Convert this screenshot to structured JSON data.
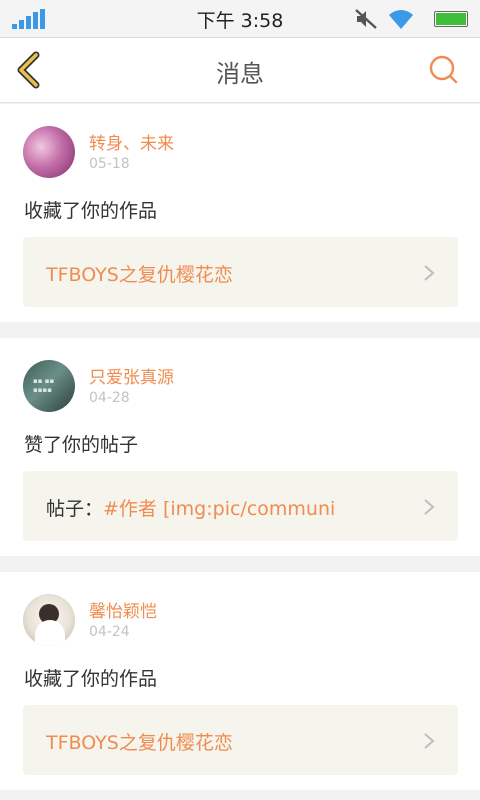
{
  "status_bar": {
    "time": "下午 3:58"
  },
  "nav": {
    "title": "消息"
  },
  "messages": [
    {
      "username": "转身、未来",
      "date": "05-18",
      "action": "收藏了你的作品",
      "quote_prefix": "",
      "quote": "TFBOYS之复仇樱花恋"
    },
    {
      "username": "只爱张真源",
      "date": "04-28",
      "action": "赞了你的帖子",
      "quote_prefix": "帖子：",
      "quote": "#作者 [img:pic/communi"
    },
    {
      "username": "馨怡颖恺",
      "date": "04-24",
      "action": "收藏了你的作品",
      "quote_prefix": "",
      "quote": "TFBOYS之复仇樱花恋"
    }
  ],
  "colors": {
    "accent": "#f08c50",
    "back_icon": "#d8b03a",
    "signal": "#3a9ae8",
    "battery": "#3fbf37"
  },
  "icons": [
    "signal-icon",
    "mute-icon",
    "wifi-icon",
    "battery-icon",
    "back-arrow-icon",
    "search-icon",
    "chevron-right-icon"
  ]
}
